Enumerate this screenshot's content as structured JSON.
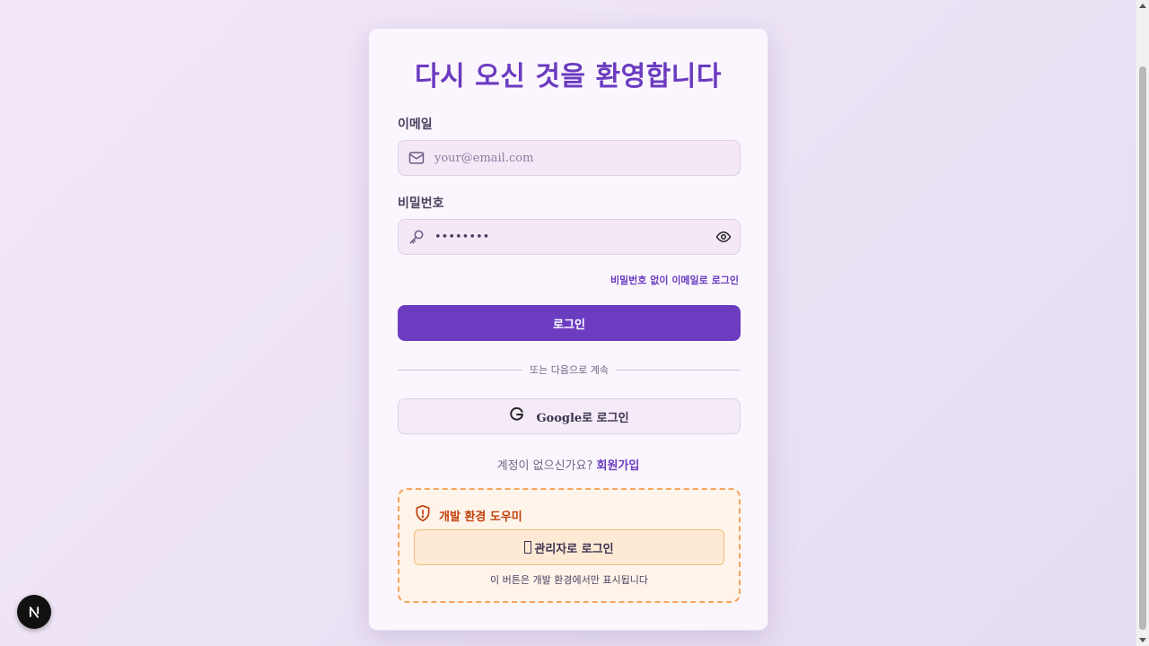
{
  "title": "다시 오신 것을 환영합니다",
  "email": {
    "label": "이메일",
    "placeholder": "your@email.com",
    "icon": "mail-icon"
  },
  "password": {
    "label": "비밀번호",
    "value": "••••••••",
    "icon": "key-icon",
    "toggle_icon": "eye-icon"
  },
  "magic_link": "비밀번호 없이 이메일로 로그인",
  "login_button": "로그인",
  "divider_text": "또는 다음으로 계속",
  "google_button": "Google로 로그인",
  "signup": {
    "prompt": "계정이 없으신가요?",
    "link": "회원가입"
  },
  "dev_helper": {
    "title": "개발 환경 도우미",
    "admin_button": "관리자로 로그인",
    "note": "이 버튼은 개발 환경에서만 표시됩니다"
  },
  "colors": {
    "accent": "#6b3bc0",
    "warning": "#c2410c",
    "dev_border": "#f5a560"
  }
}
